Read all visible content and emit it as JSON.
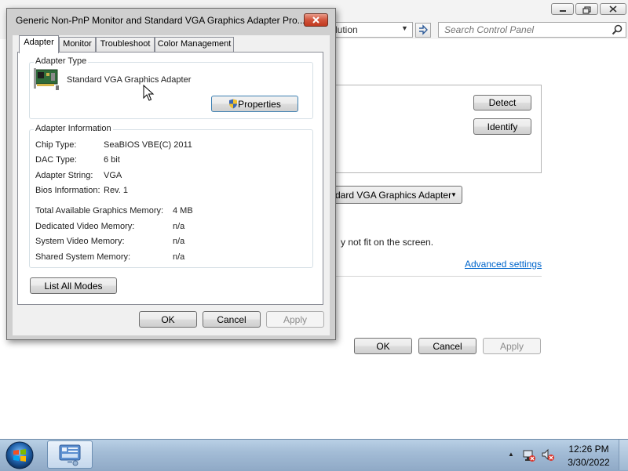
{
  "control_panel": {
    "address_tail": "lution",
    "search_placeholder": "Search Control Panel",
    "detect_button": "Detect",
    "identify_button": "Identify",
    "display_dropdown": "dard VGA Graphics Adapter",
    "fit_text": "y not fit on the screen.",
    "advanced_settings_link": "Advanced settings",
    "ok_button": "OK",
    "cancel_button": "Cancel",
    "apply_button": "Apply",
    "caption_buttons": [
      "minimize",
      "maximize",
      "close"
    ]
  },
  "dialog": {
    "title": "Generic Non-PnP Monitor and Standard VGA Graphics Adapter Pro...",
    "tabs": [
      "Adapter",
      "Monitor",
      "Troubleshoot",
      "Color Management"
    ],
    "active_tab": "Adapter",
    "adapter_type": {
      "label": "Adapter Type",
      "name": "Standard VGA Graphics Adapter",
      "properties_button": "Properties"
    },
    "adapter_info": {
      "label": "Adapter Information",
      "rows": [
        {
          "label": "Chip Type:",
          "value": "SeaBIOS VBE(C) 2011"
        },
        {
          "label": "DAC Type:",
          "value": "6 bit"
        },
        {
          "label": "Adapter String:",
          "value": "VGA"
        },
        {
          "label": "Bios Information:",
          "value": "Rev. 1"
        }
      ],
      "memory": [
        {
          "label": "Total Available Graphics Memory:",
          "value": "4 MB"
        },
        {
          "label": "Dedicated Video Memory:",
          "value": "n/a"
        },
        {
          "label": "System Video Memory:",
          "value": "n/a"
        },
        {
          "label": "Shared System Memory:",
          "value": "n/a"
        }
      ]
    },
    "list_all_modes_button": "List All Modes",
    "ok_button": "OK",
    "cancel_button": "Cancel",
    "apply_button": "Apply"
  },
  "taskbar": {
    "time": "12:26 PM",
    "date": "3/30/2022",
    "tray_icons": [
      "show-hidden-icons-arrow",
      "network-icon",
      "volume-muted-icon"
    ]
  },
  "colors": {
    "link": "#0066cc",
    "close_button": "#c1391f",
    "taskbar": "#a3bcd6"
  }
}
